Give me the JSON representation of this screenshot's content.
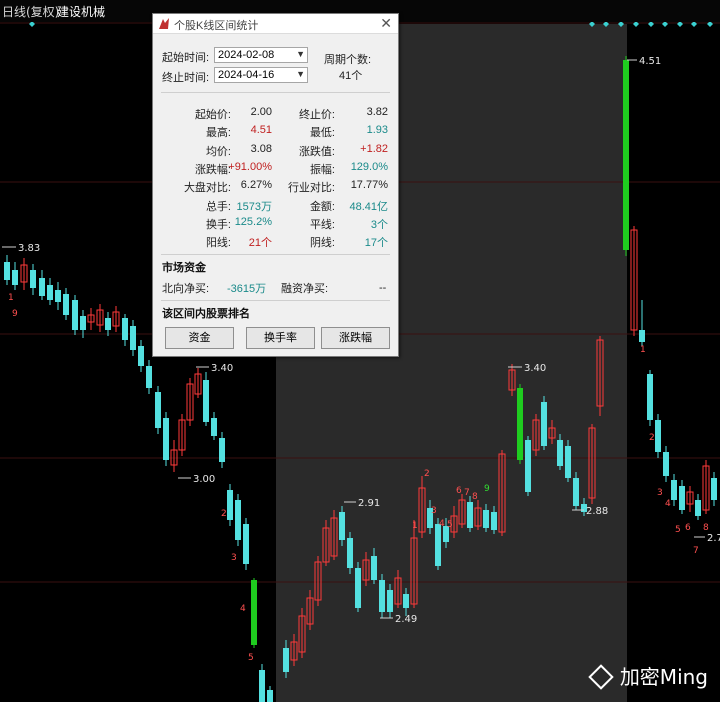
{
  "header": {
    "chart_type": "日线(复权)",
    "stock_name": "建设机械"
  },
  "dialog": {
    "title": "个股K线区间统计",
    "start_label": "起始时间:",
    "start_value": "2024-02-08",
    "end_label": "终止时间:",
    "end_value": "2024-04-16",
    "period_label": "周期个数:",
    "period_value": "41个",
    "stats": [
      {
        "l1": "起始价:",
        "v1": "2.00",
        "c1": "blk",
        "l2": "终止价:",
        "v2": "3.82",
        "c2": "blk"
      },
      {
        "l1": "最高:",
        "v1": "4.51",
        "c1": "red",
        "l2": "最低:",
        "v2": "1.93",
        "c2": "teal"
      },
      {
        "l1": "均价:",
        "v1": "3.08",
        "c1": "blk",
        "l2": "涨跌值:",
        "v2": "+1.82",
        "c2": "red"
      },
      {
        "l1": "涨跌幅:",
        "v1": "+91.00%",
        "c1": "red",
        "l2": "振幅:",
        "v2": "129.0%",
        "c2": "teal"
      },
      {
        "l1": "大盘对比:",
        "v1": "6.27%",
        "c1": "blk",
        "l2": "行业对比:",
        "v2": "17.77%",
        "c2": "blk"
      },
      {
        "l1": "总手:",
        "v1": "1573万",
        "c1": "teal",
        "l2": "金额:",
        "v2": "48.41亿",
        "c2": "teal"
      },
      {
        "l1": "换手:",
        "v1": "125.2%",
        "c1": "teal",
        "l2": "平线:",
        "v2": "3个",
        "c2": "teal"
      },
      {
        "l1": "阳线:",
        "v1": "21个",
        "c1": "red",
        "l2": "阴线:",
        "v2": "17个",
        "c2": "teal"
      }
    ],
    "market_section": "市场资金",
    "north_label": "北向净买:",
    "north_value": "-3615万",
    "margin_label": "融资净买:",
    "margin_value": "--",
    "rank_section": "该区间内股票排名",
    "buttons": [
      "资金",
      "换手率",
      "涨跌幅"
    ]
  },
  "chart_labels": {
    "high_left": "3.83",
    "mid_high": "3.40",
    "low1": "3.00",
    "p291": "2.91",
    "p249": "2.49",
    "right_340": "3.40",
    "p288": "2.88",
    "top_451": "4.51",
    "p27": "2.7"
  },
  "watermark": "加密Ming",
  "colors": {
    "up": "#ff3a3a",
    "down": "#54e0e0",
    "sel_up": "#1fcc1f",
    "bg": "#000000",
    "highlight": "#2a2a2a",
    "label": "#e8e8e8",
    "count": "#ff5050"
  }
}
